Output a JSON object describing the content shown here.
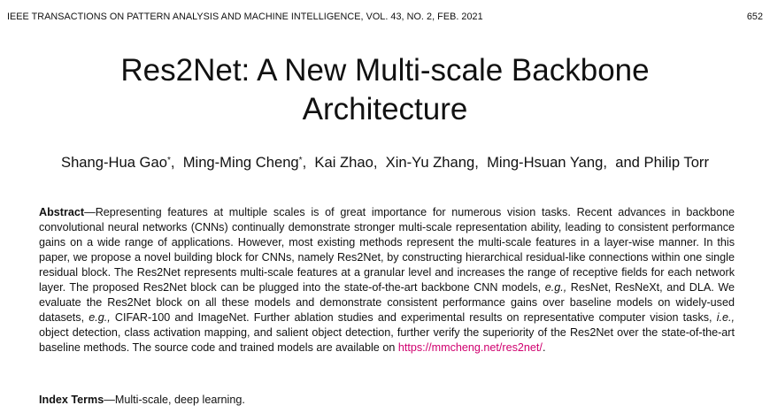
{
  "header": {
    "journal": "IEEE TRANSACTIONS ON PATTERN ANALYSIS AND MACHINE INTELLIGENCE, VOL. 43, NO. 2, FEB. 2021",
    "page_number": "652"
  },
  "paper": {
    "title_line1": "Res2Net: A New Multi-scale Backbone",
    "title_line2": "Architecture",
    "authors": [
      {
        "name": "Shang-Hua Gao",
        "mark": "*"
      },
      {
        "name": "Ming-Ming Cheng",
        "mark": "*"
      },
      {
        "name": "Kai Zhao",
        "mark": ""
      },
      {
        "name": "Xin-Yu Zhang",
        "mark": ""
      },
      {
        "name": "Ming-Hsuan Yang",
        "mark": ""
      },
      {
        "name": "and Philip Torr",
        "mark": ""
      }
    ],
    "author_separator": ",  "
  },
  "abstract": {
    "label": "Abstract",
    "dash": "—",
    "t1": "Representing features at multiple scales is of great importance for numerous vision tasks. Recent advances in backbone convolutional neural networks (CNNs) continually demonstrate stronger multi-scale representation ability, leading to consistent performance gains on a wide range of applications. However, most existing methods represent the multi-scale features in a layer-wise manner. In this paper, we propose a novel building block for CNNs, namely Res2Net, by constructing hierarchical residual-like connections within one single residual block. The Res2Net represents multi-scale features at a granular level and increases the range of receptive fields for each network layer. The proposed Res2Net block can be plugged into the state-of-the-art backbone CNN models, ",
    "i1": "e.g.,",
    "t2": " ResNet, ResNeXt, and DLA. We evaluate the Res2Net block on all these models and demonstrate consistent performance gains over baseline models on widely-used datasets, ",
    "i2": "e.g.,",
    "t3": " CIFAR-100 and ImageNet. Further ablation studies and experimental results on representative computer vision tasks, ",
    "i3": "i.e.,",
    "t4": " object detection, class activation mapping, and salient object detection, further verify the superiority of the Res2Net over the state-of-the-art baseline methods. The source code and trained models are available on ",
    "link": "https://mmcheng.net/res2net/",
    "t5": "."
  },
  "index_terms": {
    "label": "Index Terms",
    "dash": "—",
    "text": "Multi-scale, deep learning."
  },
  "colors": {
    "text": "#111111",
    "link": "#d0006f"
  }
}
